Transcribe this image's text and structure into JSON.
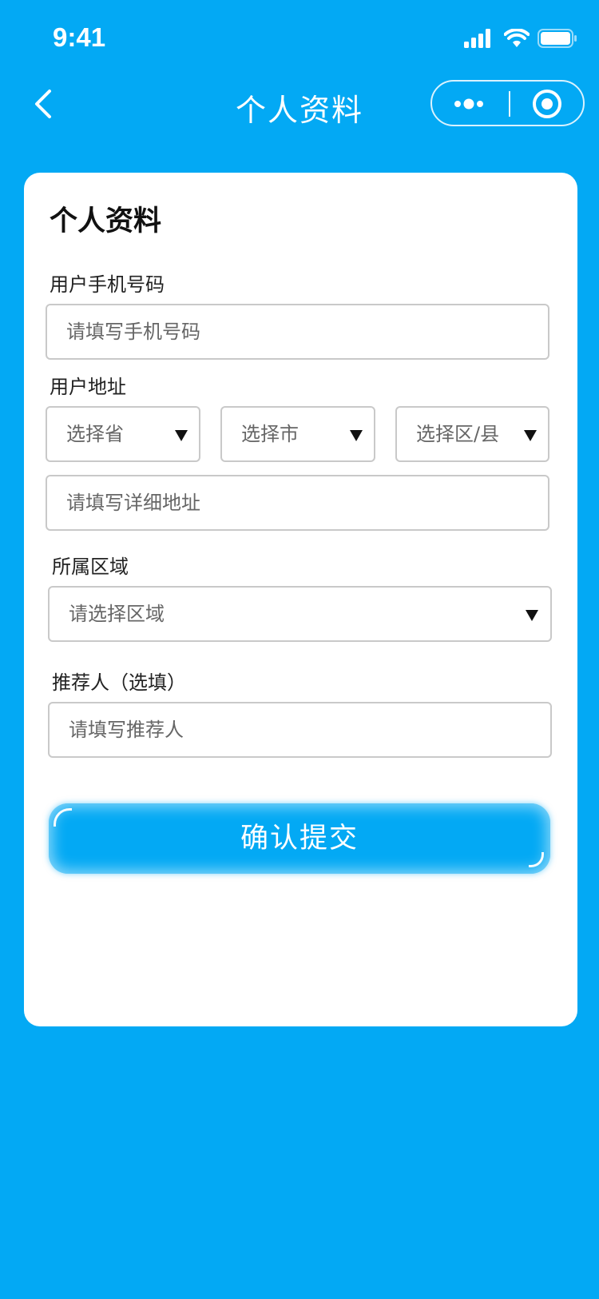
{
  "status_bar": {
    "time": "9:41"
  },
  "nav": {
    "title": "个人资料"
  },
  "form": {
    "title": "个人资料",
    "phone": {
      "label": "用户手机号码",
      "placeholder": "请填写手机号码"
    },
    "address": {
      "label": "用户地址",
      "province_placeholder": "选择省",
      "city_placeholder": "选择市",
      "district_placeholder": "选择区/县",
      "detail_placeholder": "请填写详细地址"
    },
    "region": {
      "label": "所属区域",
      "placeholder": "请选择区域"
    },
    "referrer": {
      "label": "推荐人（选填）",
      "placeholder": "请填写推荐人"
    },
    "submit_label": "确认提交"
  },
  "colors": {
    "background": "#03a9f4",
    "card": "#ffffff",
    "button": "#03a9f4"
  }
}
